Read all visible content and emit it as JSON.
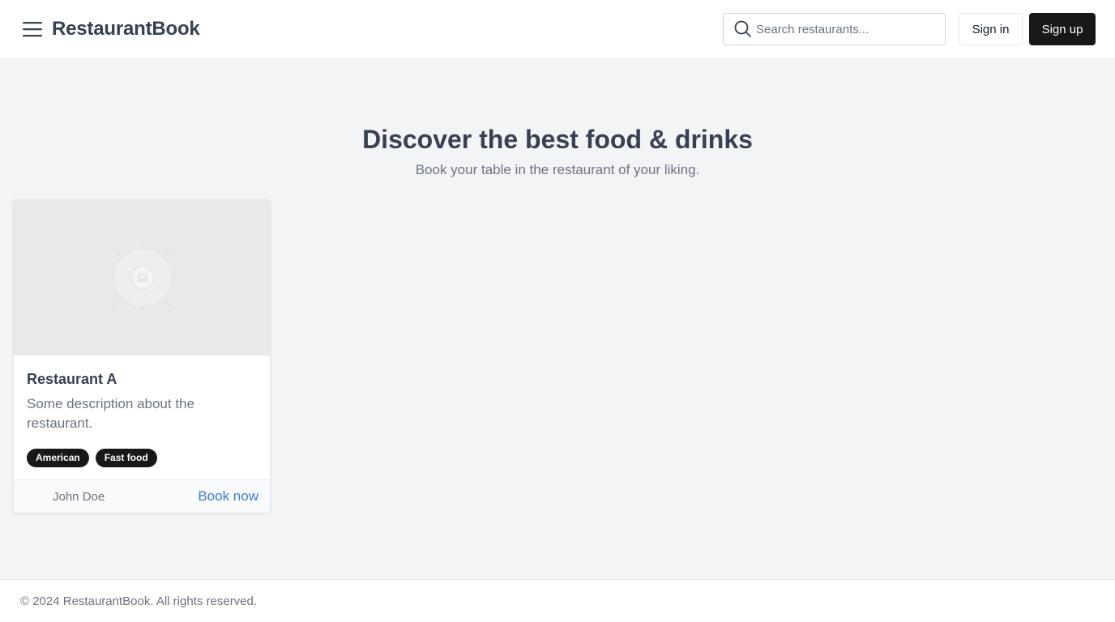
{
  "header": {
    "menu_icon": "hamburger-menu-icon",
    "brand": "RestaurantBook",
    "search_placeholder": "Search restaurants...",
    "search_icon": "search-icon",
    "signin_label": "Sign in",
    "signup_label": "Sign up"
  },
  "hero": {
    "title": "Discover the best food & drinks",
    "subtitle": "Book your table in the restaurant of your liking."
  },
  "restaurants": [
    {
      "image_icon": "image-placeholder-icon",
      "name": "Restaurant A",
      "description": "Some description about the restaurant.",
      "tags": [
        "American",
        "Fast food"
      ],
      "owner": "John Doe",
      "cta": "Book now"
    }
  ],
  "footer": {
    "copyright": "© 2024 RestaurantBook. All rights reserved."
  },
  "colors": {
    "page_bg": "#f3f4f6",
    "primary_dark": "#18181b",
    "link_blue": "#3b7dd8"
  }
}
